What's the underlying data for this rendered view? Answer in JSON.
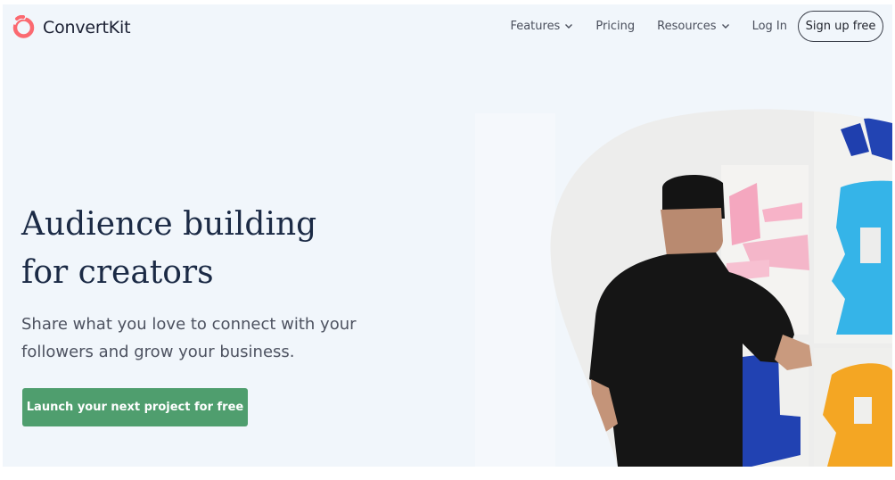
{
  "brand": {
    "name": "ConvertKit",
    "accent": "#fb6970"
  },
  "nav": {
    "items": [
      {
        "label": "Features",
        "has_dropdown": true
      },
      {
        "label": "Pricing",
        "has_dropdown": false
      },
      {
        "label": "Resources",
        "has_dropdown": true
      },
      {
        "label": "Log In",
        "has_dropdown": false
      }
    ],
    "signup_label": "Sign up free"
  },
  "hero": {
    "headline_line1": "Audience building",
    "headline_line2": "for creators",
    "subtext_line1": "Share what you love to connect with your",
    "subtext_line2": "followers and grow your business.",
    "cta_label": "Launch your next project for free",
    "cta_color": "#4f9e6e",
    "image": {
      "subject": "person-painting-mural"
    }
  }
}
